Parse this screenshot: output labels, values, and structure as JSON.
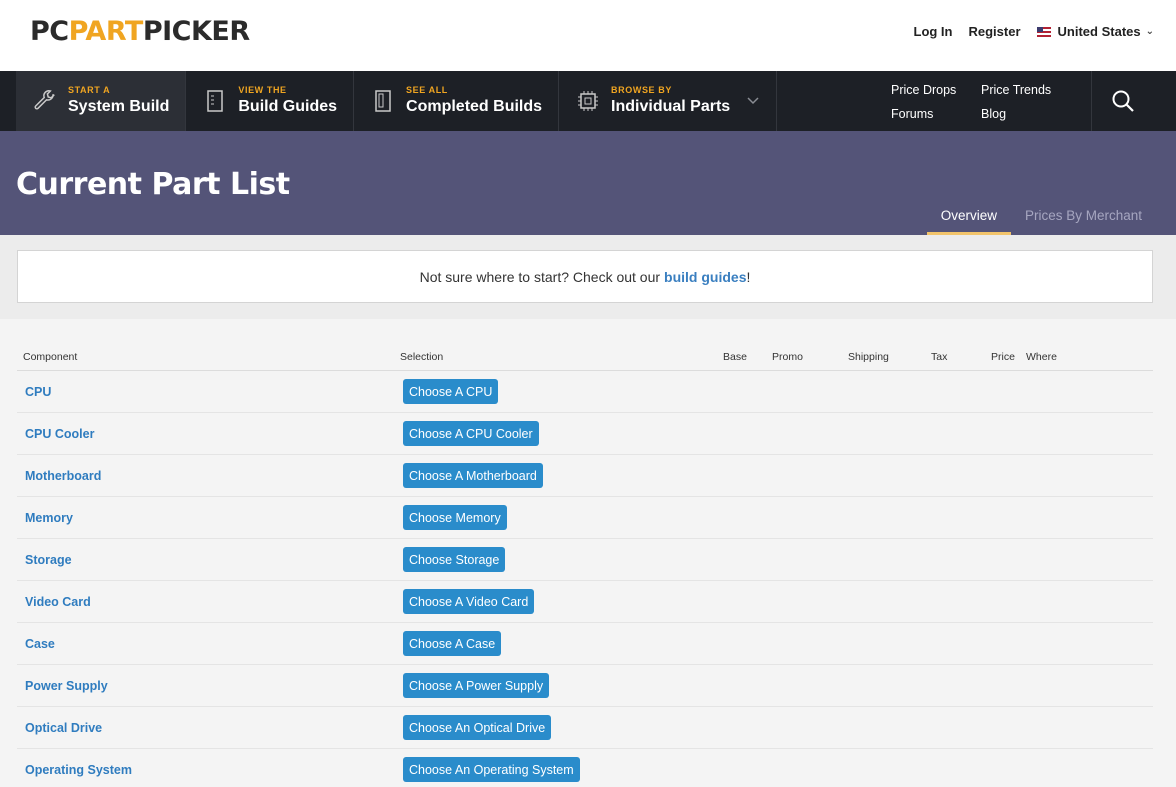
{
  "brand": {
    "part1": "PC",
    "part2": "PART",
    "part3": "PICKER"
  },
  "top_links": {
    "login": "Log In",
    "register": "Register",
    "country": "United States"
  },
  "nav": {
    "items": [
      {
        "small": "START A",
        "big": "System Build",
        "icon": "wrench-icon"
      },
      {
        "small": "VIEW THE",
        "big": "Build Guides",
        "icon": "guide-icon"
      },
      {
        "small": "SEE ALL",
        "big": "Completed Builds",
        "icon": "case-icon"
      },
      {
        "small": "BROWSE BY",
        "big": "Individual Parts",
        "icon": "chip-icon"
      }
    ],
    "links": {
      "price_drops": "Price Drops",
      "price_trends": "Price Trends",
      "forums": "Forums",
      "blog": "Blog"
    }
  },
  "page": {
    "title": "Current Part List",
    "tabs": [
      "Overview",
      "Prices By Merchant"
    ]
  },
  "notice": {
    "text": "Not sure where to start? Check out our",
    "link": "build guides",
    "suffix": "!"
  },
  "table": {
    "headers": {
      "component": "Component",
      "selection": "Selection",
      "base": "Base",
      "promo": "Promo",
      "shipping": "Shipping",
      "tax": "Tax",
      "price": "Price",
      "where": "Where"
    },
    "rows": [
      {
        "component": "CPU",
        "button": "Choose A CPU"
      },
      {
        "component": "CPU Cooler",
        "button": "Choose A CPU Cooler"
      },
      {
        "component": "Motherboard",
        "button": "Choose A Motherboard"
      },
      {
        "component": "Memory",
        "button": "Choose Memory"
      },
      {
        "component": "Storage",
        "button": "Choose Storage"
      },
      {
        "component": "Video Card",
        "button": "Choose A Video Card"
      },
      {
        "component": "Case",
        "button": "Choose A Case"
      },
      {
        "component": "Power Supply",
        "button": "Choose A Power Supply"
      },
      {
        "component": "Optical Drive",
        "button": "Choose An Optical Drive"
      },
      {
        "component": "Operating System",
        "button": "Choose An Operating System"
      }
    ]
  },
  "colors": {
    "accent": "#f0a521",
    "banner": "#545478",
    "nav": "#1d2026",
    "button": "#2a8ccb",
    "link": "#2f7cbf"
  }
}
